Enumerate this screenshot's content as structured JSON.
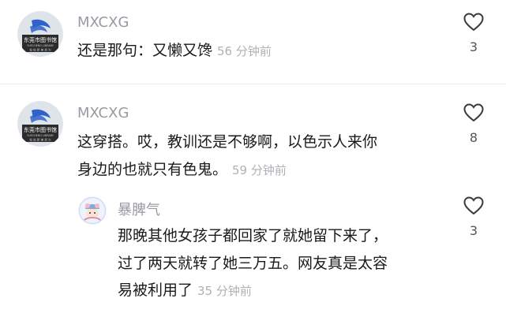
{
  "comments": [
    {
      "username": "MXCXG",
      "lines": [
        "还是那句：又懒又馋"
      ],
      "time": "56 分钟前",
      "likes": "3",
      "avatar_text": [
        "东莞市图书馆",
        "YUECHENG LIBRARY",
        "松 松 新 美 资 为"
      ]
    },
    {
      "username": "MXCXG",
      "lines": [
        "这穿搭。哎，教训还是不够啊，以色示人来你",
        "身边的也就只有色鬼。"
      ],
      "time": "59 分钟前",
      "likes": "8",
      "avatar_text": [
        "东莞市图书馆",
        "YUECHENG LIBRARY",
        "松 松 新 美 资 为"
      ]
    }
  ],
  "reply": {
    "username": "暴脾气",
    "lines": [
      "那晚其他女孩子都回家了就她留下来了，",
      "过了两天就转了她三万五。网友真是太容",
      "易被利用了"
    ],
    "time": "35 分钟前",
    "likes": "3"
  },
  "colors": {
    "username": "#9a9aa3",
    "text": "#1a1a1a",
    "time": "#b0b0b6",
    "avatar_logo_blue": "#2f63c9"
  }
}
